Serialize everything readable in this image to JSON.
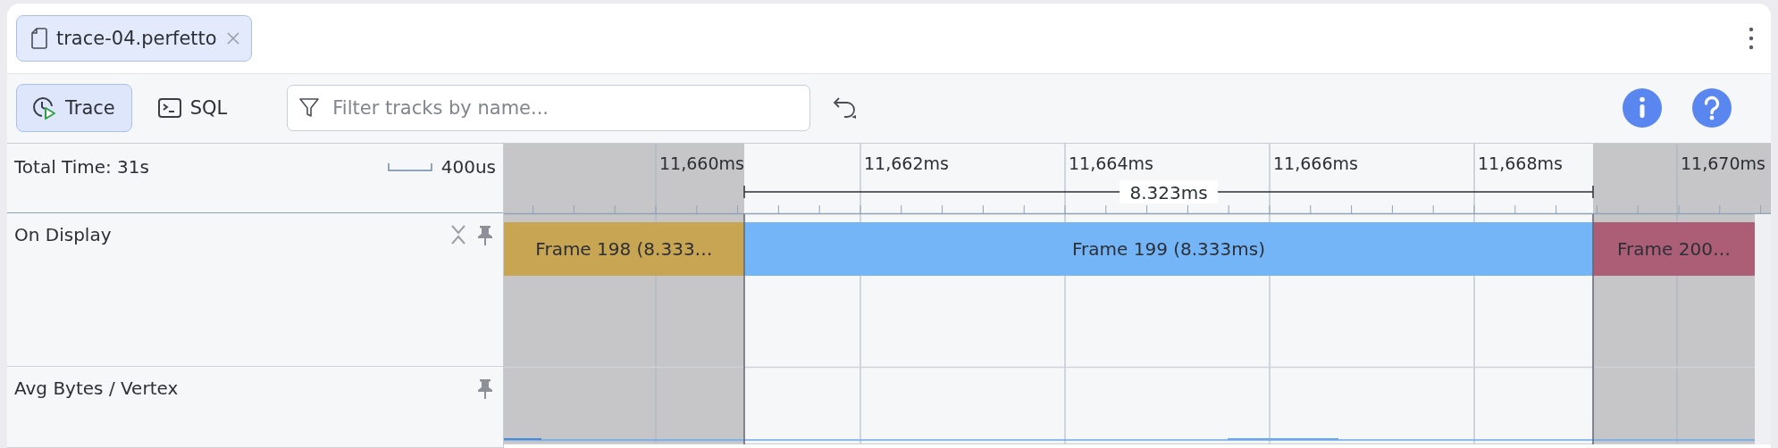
{
  "tab": {
    "title": "trace-04.perfetto",
    "selected": true
  },
  "toolbar": {
    "modes": [
      {
        "label": "Trace",
        "kind": "trace",
        "selected": true
      },
      {
        "label": "SQL",
        "kind": "sql",
        "selected": false
      }
    ],
    "filter": {
      "placeholder": "Filter tracks by name..."
    }
  },
  "timeline": {
    "total_time": "Total Time: 31s",
    "scale_label": "400us",
    "ticks": [
      "11,660ms",
      "11,662ms",
      "11,664ms",
      "11,666ms",
      "11,668ms",
      "11,670ms"
    ],
    "selection": {
      "duration": "8.323ms"
    }
  },
  "tracks": [
    {
      "name": "On Display",
      "kind": "slices",
      "slices": [
        {
          "label": "Frame 198 (8.333…",
          "color": "#c7a553"
        },
        {
          "label": "Frame 199 (8.333ms)",
          "color": "#74b5f7"
        },
        {
          "label": "Frame 200…",
          "color": "#ad5e77"
        }
      ]
    },
    {
      "name": "Avg Bytes / Vertex",
      "kind": "counter"
    }
  ]
}
